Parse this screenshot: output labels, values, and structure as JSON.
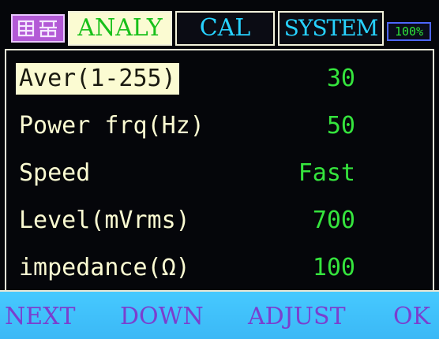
{
  "colors": {
    "background": "#05060a",
    "label_text": "#fbfbd2",
    "value_text": "#35e43d",
    "tab_text": "#27d2ff",
    "active_tab_bg": "#fbfbd2",
    "active_tab_text": "#18c01a",
    "softbar_bg": "#46c9ff",
    "softkey_text": "#7a3fcf",
    "logo_bg": "#b35ad6"
  },
  "header": {
    "logo_icon": "brand-logo-icon",
    "tabs": [
      {
        "label": "ANALY",
        "active": true
      },
      {
        "label": "CAL",
        "active": false
      },
      {
        "label": "SYSTEM",
        "active": false
      }
    ],
    "battery": "100%"
  },
  "settings": [
    {
      "label": "Aver(1-255)",
      "value": "30",
      "selected": true
    },
    {
      "label": "Power frq(Hz)",
      "value": "50",
      "selected": false
    },
    {
      "label": "Speed",
      "value": "Fast",
      "selected": false
    },
    {
      "label": "Level(mVrms)",
      "value": "700",
      "selected": false
    },
    {
      "label": "impedance(Ω)",
      "value": "100",
      "selected": false
    }
  ],
  "softkeys": [
    "NEXT",
    "DOWN",
    "ADJUST",
    "OK"
  ]
}
